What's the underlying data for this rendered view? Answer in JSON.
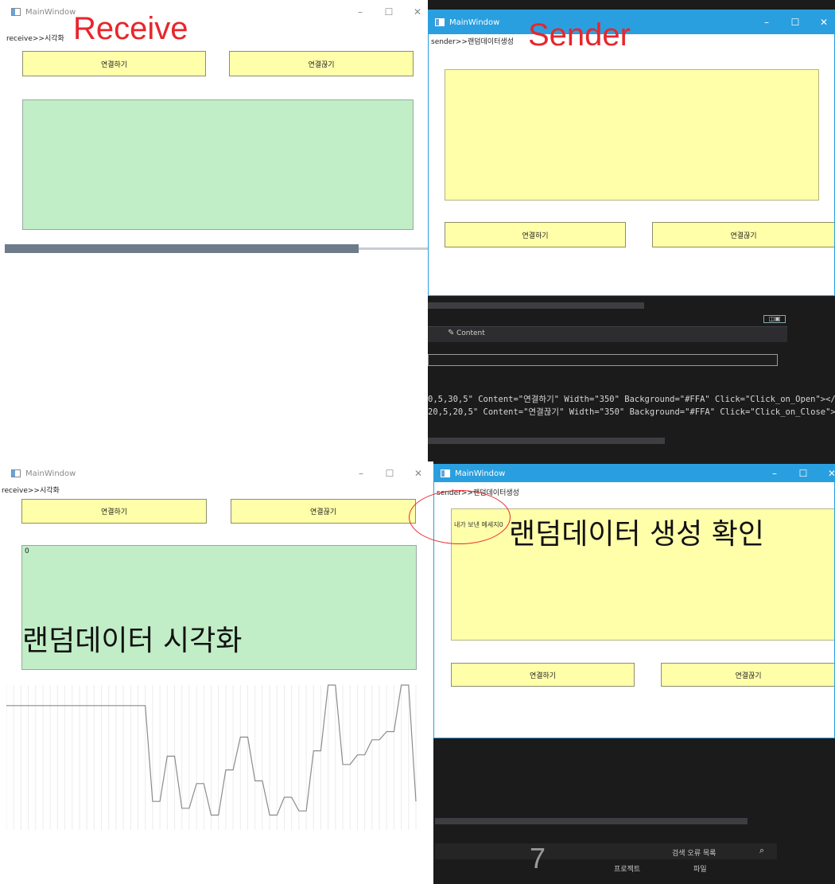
{
  "receive_top": {
    "window_title": "MainWindow",
    "overlay_label": "Receive",
    "menu_text": "receive>>시각화",
    "connect_label": "연결하기",
    "disconnect_label": "연결끊기",
    "controls": [
      "–",
      "☐",
      "✕"
    ]
  },
  "sender_top": {
    "window_title": "MainWindow",
    "overlay_label": "Sender",
    "menu_text": "sender>>랜덤데이터생성",
    "connect_label": "연결하기",
    "disconnect_label": "연결끊기",
    "controls": [
      "–",
      "☐",
      "✕"
    ]
  },
  "editor": {
    "properties_tab": "Content",
    "code_line_1": "0,5,30,5\" Content=\"연결하기\" Width=\"350\" Background=\"#FFA\" Click=\"Click_on_Open\"></",
    "code_line_2": "20,5,20,5\" Content=\"연결끊기\" Width=\"350\" Background=\"#FFA\" Click=\"Click_on_Close\">",
    "error_search_placeholder": "검색 오류 목록",
    "bottom_tab_project": "프로젝트",
    "bottom_tab_file": "파일"
  },
  "receive_bottom": {
    "window_title": "MainWindow",
    "menu_text": "receive>>시각화",
    "connect_label": "연결하기",
    "disconnect_label": "연결끊기",
    "value_text": "0",
    "annotation": "랜덤데이터 시각화",
    "controls": [
      "–",
      "☐",
      "✕"
    ],
    "chart_values": [
      85,
      85,
      85,
      85,
      85,
      85,
      85,
      85,
      85,
      85,
      85,
      85,
      85,
      85,
      85,
      85,
      85,
      85,
      85,
      85,
      15,
      15,
      48,
      48,
      10,
      10,
      28,
      28,
      5,
      5,
      38,
      38,
      62,
      62,
      30,
      30,
      5,
      5,
      18,
      18,
      8,
      8,
      52,
      52,
      100,
      100,
      42,
      42,
      49,
      49,
      60,
      60,
      66,
      66,
      100,
      100,
      15
    ]
  },
  "sender_bottom": {
    "window_title": "MainWindow",
    "menu_text": "sender>>랜덤데이터생성",
    "message_text": "내가 보낸 메세지0",
    "annotation": "랜덤데이터 생성 확인",
    "connect_label": "연결하기",
    "disconnect_label": "연결끊기",
    "controls": [
      "–",
      "☐",
      "✕"
    ]
  },
  "page_number": "7",
  "colors": {
    "button_fill": "#FFFFAA",
    "receive_area": "#C1EDC7",
    "sender_titlebar": "#2A9FDF",
    "annotation_red": "#E8262B",
    "ide_dark": "#1B1B1C"
  }
}
